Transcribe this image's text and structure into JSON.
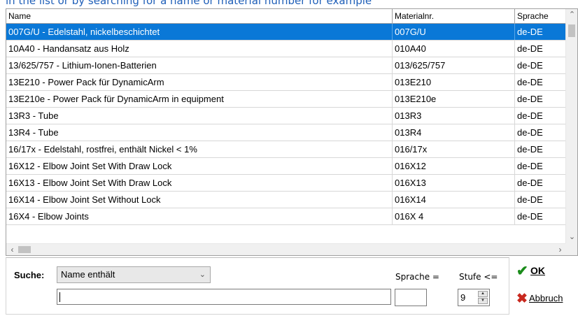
{
  "instruction": "in the list or by searching for a name or material number for example",
  "table": {
    "columns": [
      "Name",
      "Materialnr.",
      "Sprache"
    ],
    "rows": [
      {
        "name": "007G/U - Edelstahl, nickelbeschichtet",
        "material": "007G/U",
        "lang": "de-DE"
      },
      {
        "name": "10A40 - Handansatz aus Holz",
        "material": "010A40",
        "lang": "de-DE"
      },
      {
        "name": "13/625/757 -  Lithium-Ionen-Batterien",
        "material": "013/625/757",
        "lang": "de-DE"
      },
      {
        "name": "13E210 - Power Pack für DynamicArm",
        "material": "013E210",
        "lang": "de-DE"
      },
      {
        "name": "13E210e -  Power Pack für DynamicArm in equipment",
        "material": "013E210e",
        "lang": "de-DE"
      },
      {
        "name": "13R3 - Tube",
        "material": "013R3",
        "lang": "de-DE"
      },
      {
        "name": "13R4 - Tube",
        "material": "013R4",
        "lang": "de-DE"
      },
      {
        "name": "16/17x - Edelstahl, rostfrei, enthält Nickel < 1%",
        "material": "016/17x",
        "lang": "de-DE"
      },
      {
        "name": "16X12 - Elbow Joint Set With Draw Lock",
        "material": "016X12",
        "lang": "de-DE"
      },
      {
        "name": "16X13 - Elbow Joint Set With Draw Lock",
        "material": "016X13",
        "lang": "de-DE"
      },
      {
        "name": "16X14 - Elbow Joint Set Without Lock",
        "material": "016X14",
        "lang": "de-DE"
      },
      {
        "name": "16X4 - Elbow Joints",
        "material": "016X 4",
        "lang": "de-DE"
      }
    ]
  },
  "search": {
    "label": "Suche:",
    "mode": "Name  enthält",
    "value": "",
    "lang_label": "Sprache =",
    "lang_value": "",
    "level_label": "Stufe <=",
    "level_value": "9"
  },
  "buttons": {
    "ok": "OK",
    "cancel": "Abbruch"
  },
  "colors": {
    "selection": "#0a78d7",
    "instruction": "#1f5fb8",
    "ok_icon": "#1a8c1a",
    "cancel_icon": "#c8281e"
  }
}
